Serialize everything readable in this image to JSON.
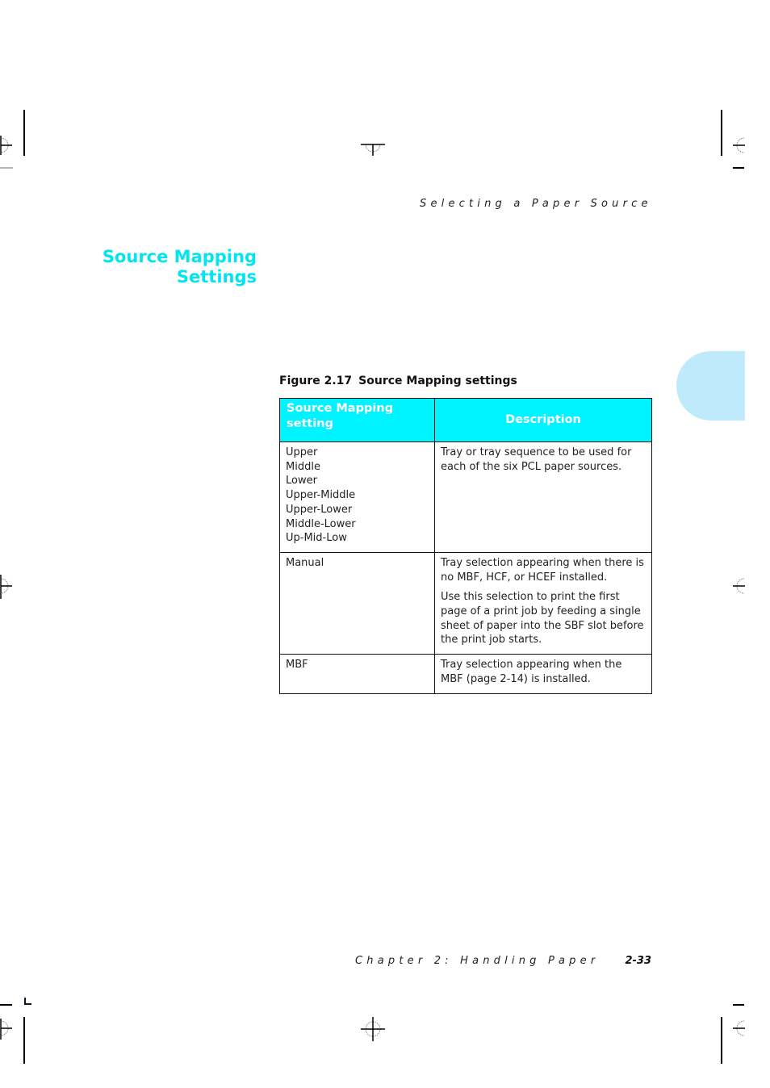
{
  "running_head": "Selecting a Paper Source",
  "section_title": {
    "line1": "Source Mapping",
    "line2": "Settings"
  },
  "figure": {
    "number": "Figure 2.17",
    "caption": "Source Mapping settings"
  },
  "table": {
    "headers": [
      "Source Mapping setting",
      "Description"
    ],
    "rows": [
      {
        "settings": [
          "Upper",
          "Middle",
          "Lower",
          "Upper-Middle",
          "Upper-Lower",
          "Middle-Lower",
          "Up-Mid-Low"
        ],
        "description": [
          "Tray or tray sequence to be used for each of the six PCL paper sources."
        ]
      },
      {
        "settings": [
          "Manual"
        ],
        "description": [
          "Tray selection appearing when there is no MBF, HCF, or HCEF installed.",
          "Use this selection to print the first page of a print job by feeding a single sheet of paper into the SBF slot before the print job starts."
        ]
      },
      {
        "settings": [
          "MBF"
        ],
        "description": [
          "Tray selection appearing when the MBF (page 2-14) is installed."
        ]
      }
    ]
  },
  "footer": {
    "chapter": "Chapter 2: Handling Paper",
    "page": "2-33"
  },
  "colors": {
    "accent_cyan": "#00e5f0",
    "header_fill": "#00f4ff",
    "chapter_tab": "#bfeafb"
  },
  "icons": {
    "registration_mark": "registration-mark-icon",
    "crop_mark": "crop-mark-icon"
  }
}
